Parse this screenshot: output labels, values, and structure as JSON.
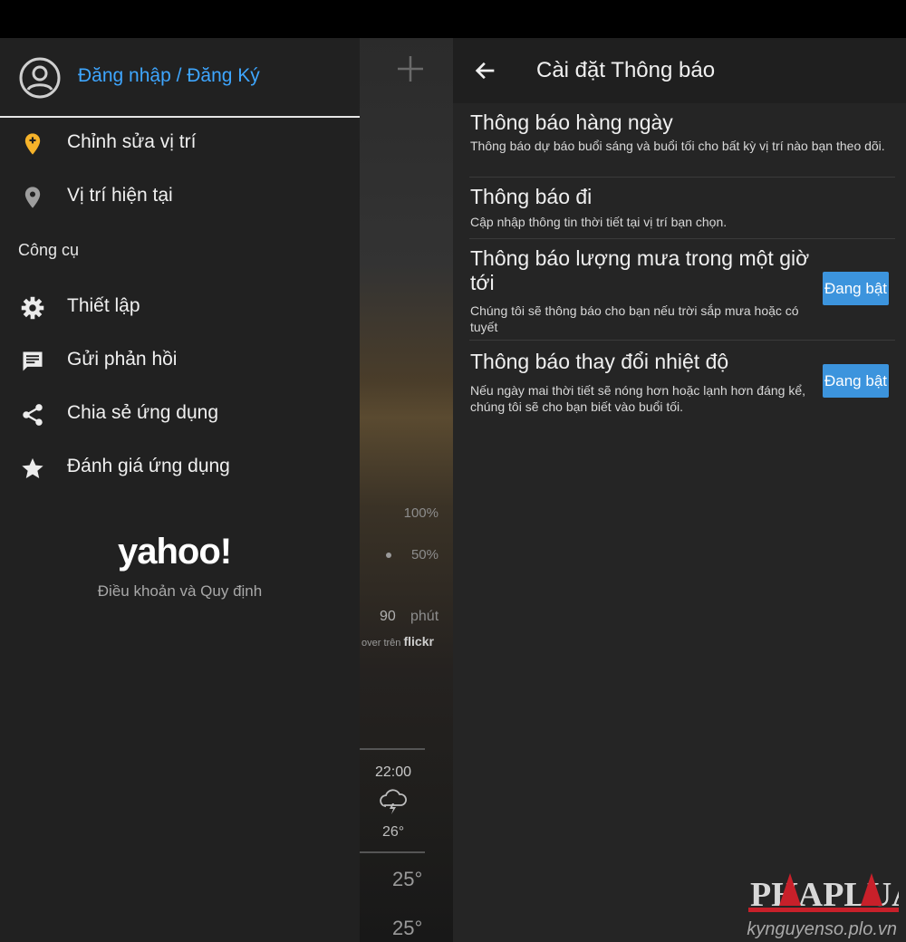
{
  "drawer": {
    "account_label": "Đăng nhập / Đăng Ký",
    "items": [
      {
        "label": "Chỉnh sửa vị trí",
        "icon": "location-pin-add-icon",
        "icon_color": "#f6b32a"
      },
      {
        "label": "Vị trí hiện tại",
        "icon": "location-pin-icon",
        "icon_color": "#9e9e9e"
      }
    ],
    "section_title": "Công cụ",
    "tools": [
      {
        "label": "Thiết lập",
        "icon": "gear-icon"
      },
      {
        "label": "Gửi phản hồi",
        "icon": "feedback-icon"
      },
      {
        "label": "Chia sẻ ứng dụng",
        "icon": "share-icon"
      },
      {
        "label": "Đánh giá ứng dụng",
        "icon": "star-icon"
      }
    ],
    "logo_text": "yahoo!",
    "terms": "Điều khoản và Quy định"
  },
  "strip": {
    "pct_top": "100%",
    "pct_mid": "50%",
    "minutes_value": "90",
    "minutes_label": "phút",
    "credit_prefix": "over trên",
    "credit_brand": "flickr",
    "hour": "22:00",
    "temp_hour": "26°",
    "temp_a": "25°",
    "temp_b": "25°"
  },
  "settings": {
    "title": "Cài đặt Thông báo",
    "rows": [
      {
        "title": "Thông báo hàng ngày",
        "desc": "Thông báo dự báo buổi sáng và buổi tối cho bất kỳ vị trí nào bạn theo dõi."
      },
      {
        "title": "Thông báo đi",
        "desc": "Cập nhập thông tin thời tiết tại vị trí bạn chọn."
      },
      {
        "title": "Thông báo lượng mưa trong một giờ tới",
        "desc": "Chúng tôi sẽ thông báo cho bạn nếu trời sắp mưa hoặc có tuyết",
        "toggle": "Đang bật"
      },
      {
        "title": "Thông báo thay đổi nhiệt độ",
        "desc": "Nếu ngày mai thời tiết sẽ nóng hơn hoặc lạnh hơn đáng kể, chúng tôi sẽ cho bạn biết vào buổi tối.",
        "toggle": "Đang bật"
      }
    ]
  },
  "watermark": {
    "text": "kynguyenso.plo.vn",
    "logo_text": "PHAPLUAT"
  },
  "colors": {
    "accent": "#3ea6ff",
    "toggle": "#3c94dd",
    "pin": "#f6b32a"
  }
}
